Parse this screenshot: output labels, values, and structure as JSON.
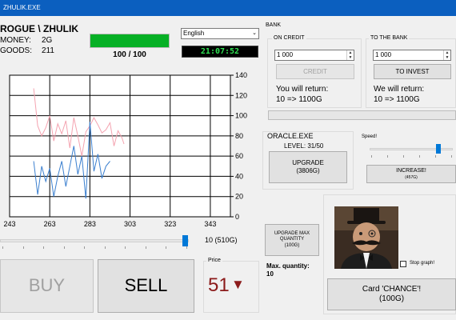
{
  "window": {
    "title": "ZHULIK.EXE"
  },
  "player": {
    "name": "ROGUE \\ ZHULIK",
    "money_label": "MONEY:",
    "money_value": "2G",
    "goods_label": "GOODS:",
    "goods_value": "211"
  },
  "health": {
    "value": "100 / 100",
    "fraction": 1.0
  },
  "language": {
    "selected": "English"
  },
  "clock": {
    "time": "21:07:52"
  },
  "bank": {
    "title": "BANK",
    "credit": {
      "title": "ON CREDIT",
      "amount": "1 000",
      "button": "CREDIT",
      "return_label": "You will return:",
      "return_value": "10 => 1100G"
    },
    "invest": {
      "title": "TO THE BANK",
      "amount": "1 000",
      "button": "TO INVEST",
      "return_label": "We will return:",
      "return_value": "10 => 1100G"
    }
  },
  "oracle": {
    "title": "ORACLE.EXE",
    "level": "LEVEL: 31/50",
    "button_line1": "UPGRADE",
    "button_line2": "(3806G)"
  },
  "speed": {
    "label": "Speed!",
    "level": 0.85,
    "button_line1": "INCREASE!",
    "button_line2": "(457G)"
  },
  "chart_data": {
    "type": "line",
    "x_ticks": [
      "243",
      "263",
      "283",
      "303",
      "323",
      "343"
    ],
    "y_ticks": [
      "0",
      "20",
      "40",
      "60",
      "80",
      "100",
      "120",
      "140"
    ],
    "xlim": [
      243,
      353
    ],
    "ylim": [
      0,
      140
    ],
    "grid": true,
    "series": [
      {
        "color": "#f4a3b0",
        "x": [
          255,
          257,
          259,
          261,
          263,
          265,
          267,
          269,
          271,
          273,
          275,
          277,
          279,
          281,
          283,
          285,
          287,
          289,
          291,
          293,
          295,
          297,
          299,
          300
        ],
        "y": [
          127,
          90,
          80,
          88,
          100,
          75,
          92,
          82,
          95,
          68,
          98,
          80,
          60,
          84,
          90,
          98,
          91,
          83,
          86,
          93,
          70,
          85,
          78,
          72
        ]
      },
      {
        "color": "#3a7fcf",
        "x": [
          255,
          257,
          259,
          261,
          263,
          265,
          267,
          269,
          271,
          273,
          275,
          277,
          279,
          281,
          283,
          285,
          287,
          289,
          291,
          293
        ],
        "y": [
          55,
          22,
          50,
          35,
          48,
          20,
          40,
          55,
          30,
          50,
          70,
          42,
          60,
          18,
          94,
          45,
          62,
          38,
          50,
          55
        ]
      }
    ]
  },
  "quantity_slider": {
    "value_text": "10 (510G)",
    "level": 0.98
  },
  "trade": {
    "buy": "BUY",
    "sell": "SELL",
    "price_label": "Price",
    "price_value": "51",
    "price_arrow": "▼"
  },
  "upgrade_quantity": {
    "line1": "UPGRADE MAX",
    "line2": "QUANTITY",
    "line3": "(100G)",
    "max_label": "Max. quantity:",
    "max_value": "10"
  },
  "portrait": {
    "stop_graph_label": "Stop graph!"
  },
  "chance": {
    "line1": "Card 'CHANCE'!",
    "line2": "(100G)"
  }
}
